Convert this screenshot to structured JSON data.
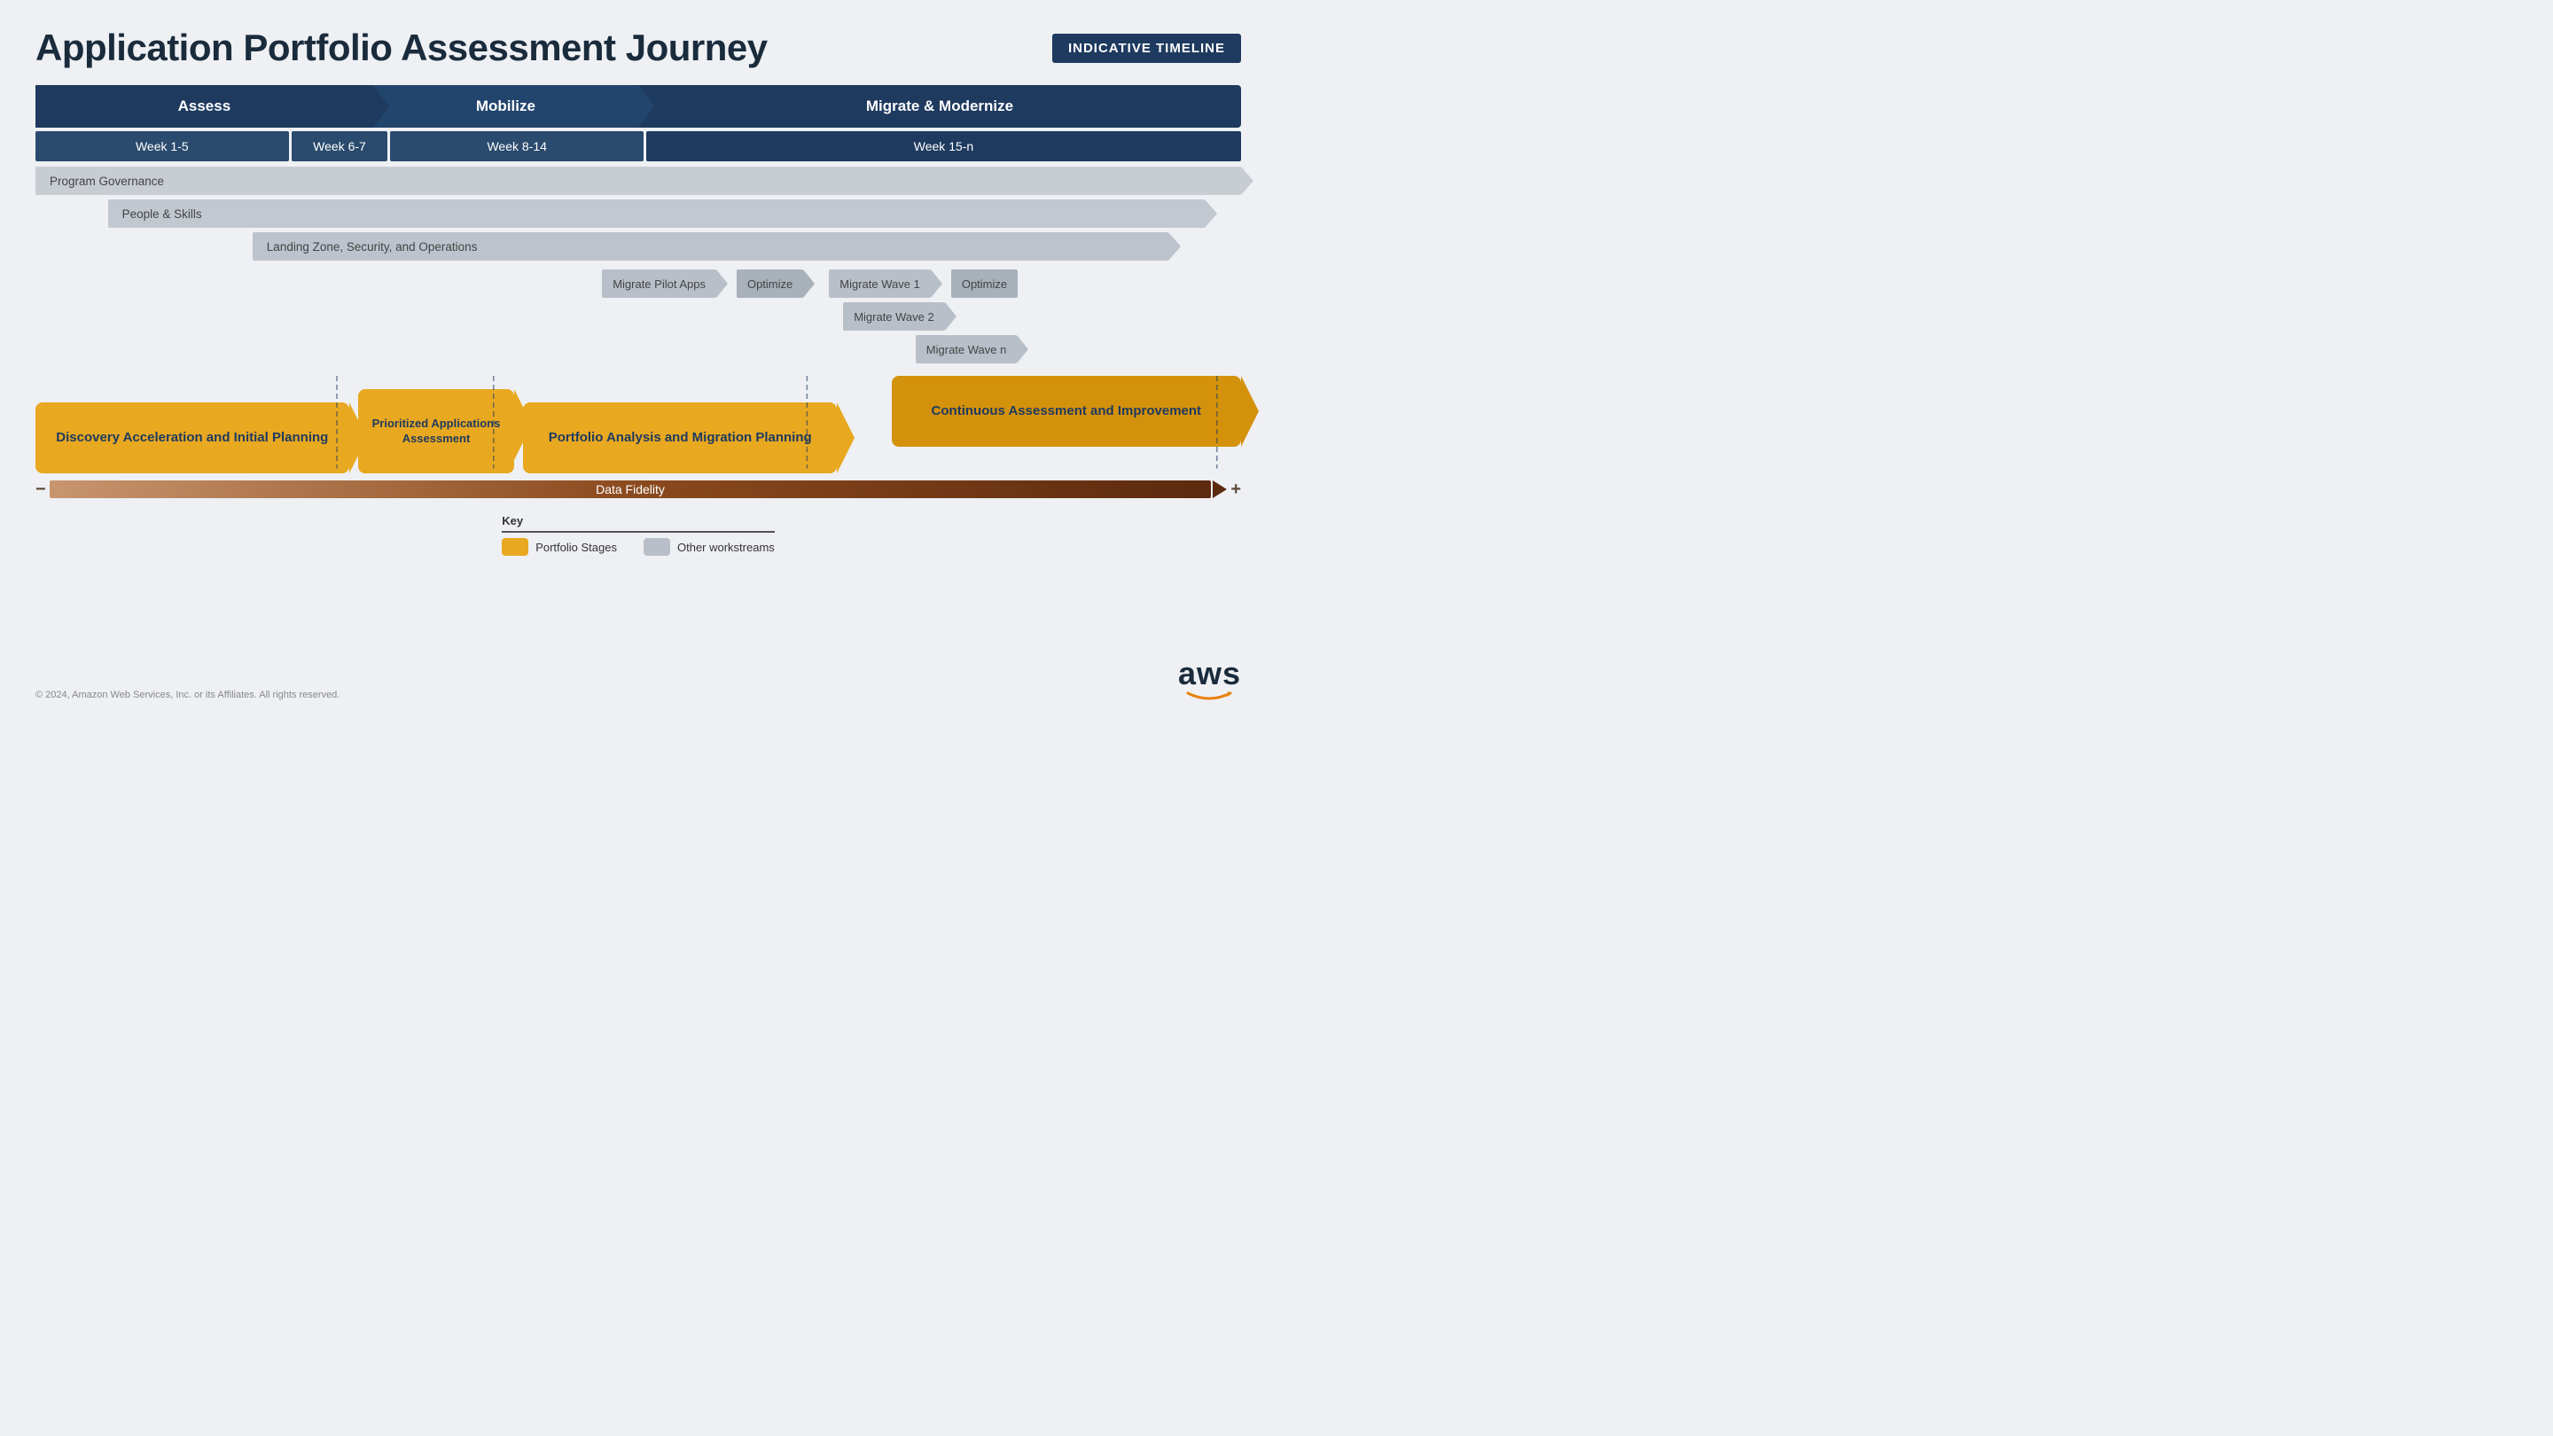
{
  "header": {
    "title": "Application Portfolio Assessment Journey",
    "badge": "INDICATIVE TIMELINE"
  },
  "phases": [
    {
      "label": "Assess",
      "type": "assess"
    },
    {
      "label": "Mobilize",
      "type": "mobilize"
    },
    {
      "label": "Migrate & Modernize",
      "type": "migrate"
    }
  ],
  "weeks": [
    {
      "label": "Week 1-5",
      "type": "w1"
    },
    {
      "label": "Week 6-7",
      "type": "w67"
    },
    {
      "label": "Week 8-14",
      "type": "w814"
    },
    {
      "label": "Week 15-n",
      "type": "w15"
    }
  ],
  "governance": [
    {
      "label": "Program Governance",
      "type": "full"
    },
    {
      "label": "People & Skills",
      "type": "people"
    },
    {
      "label": "Landing Zone, Security, and Operations",
      "type": "landing"
    }
  ],
  "migration_rows": [
    {
      "items": [
        {
          "label": "Migrate Pilot Apps",
          "type": "pilot"
        },
        {
          "label": "Optimize",
          "type": "optimize"
        },
        {
          "label": "Migrate Wave 1",
          "type": "wave1"
        },
        {
          "label": "Optimize",
          "type": "optimize"
        }
      ],
      "spacer": "47%"
    },
    {
      "items": [
        {
          "label": "Migrate Wave 2",
          "type": "wave2"
        }
      ],
      "spacer": "67%"
    },
    {
      "items": [
        {
          "label": "Migrate Wave n",
          "type": "waven"
        }
      ],
      "spacer": "73%"
    }
  ],
  "portfolio_stages": [
    {
      "label": "Discovery Acceleration and Initial Planning",
      "type": "discovery",
      "width": "25%"
    },
    {
      "label": "Prioritized Applications Assessment",
      "type": "prioritized",
      "width": "12%"
    },
    {
      "label": "Portfolio Analysis and Migration Planning",
      "type": "portfolio",
      "width": "25%"
    },
    {
      "label": "Continuous Assessment and Improvement",
      "type": "continuous",
      "width": "28%"
    }
  ],
  "fidelity": {
    "label": "Data Fidelity",
    "minus": "−",
    "plus": "+"
  },
  "key": {
    "title": "Key",
    "items": [
      {
        "label": "Portfolio Stages",
        "type": "portfolio-stage"
      },
      {
        "label": "Other workstreams",
        "type": "other-workstream"
      }
    ]
  },
  "footer": {
    "copyright": "© 2024, Amazon Web Services, Inc. or its Affiliates. All rights reserved."
  },
  "aws": {
    "text": "aws"
  }
}
